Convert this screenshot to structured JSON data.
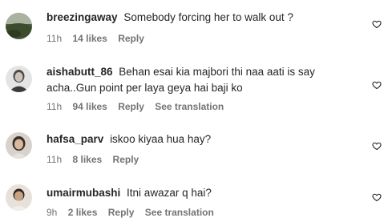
{
  "comments": [
    {
      "username": "breezingaway",
      "text": "Somebody forcing her to walk out ?",
      "time": "11h",
      "likes": "14 likes",
      "reply": "Reply",
      "translation": ""
    },
    {
      "username": "aishabutt_86",
      "text": "Behan esai kia majbori thi naa aati is say acha..Gun point per laya geya hai baji ko",
      "time": "11h",
      "likes": "94 likes",
      "reply": "Reply",
      "translation": "See translation"
    },
    {
      "username": "hafsa_parv",
      "text": "iskoo kiyaa hua hay?",
      "time": "11h",
      "likes": "8 likes",
      "reply": "Reply",
      "translation": ""
    },
    {
      "username": "umairmubashi",
      "text": "Itni awazar q hai?",
      "time": "9h",
      "likes": "2 likes",
      "reply": "Reply",
      "translation": "See translation"
    }
  ],
  "colors": {
    "text": "#262626",
    "muted": "#737373"
  }
}
